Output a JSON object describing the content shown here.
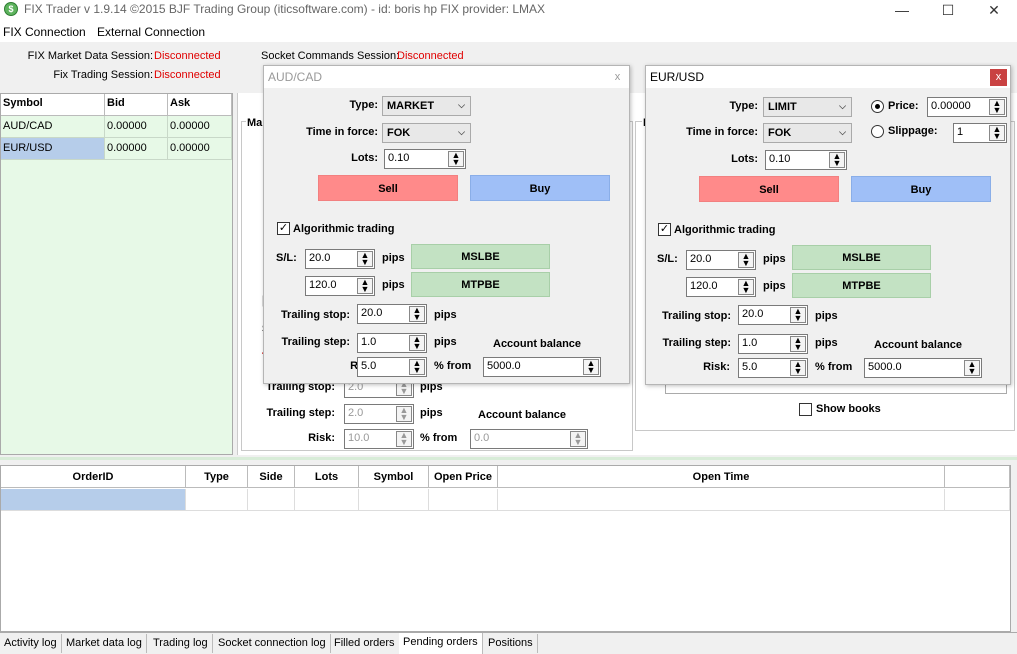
{
  "window": {
    "title": "FIX Trader v 1.9.14 ©2015 BJF Trading Group (iticsoftware.com) - id: boris hp FIX provider: LMAX",
    "min": "—",
    "max": "☐",
    "close": "✕"
  },
  "menu": [
    "FIX Connection",
    "External Connection"
  ],
  "status": {
    "md_label": "FIX Market Data Session:",
    "md_value": "Disconnected",
    "tr_label": "Fix Trading Session:",
    "tr_value": "Disconnected",
    "sock_label": "Socket Commands Session:",
    "sock_value": "Disconnected"
  },
  "symbols": {
    "headers": [
      "Symbol",
      "Bid",
      "Ask"
    ],
    "rows": [
      {
        "symbol": "AUD/CAD",
        "bid": "0.00000",
        "ask": "0.00000"
      },
      {
        "symbol": "EUR/USD",
        "bid": "0.00000",
        "ask": "0.00000"
      }
    ]
  },
  "main_panel": {
    "frag1": "Ma",
    "frag2": "E",
    "frag3": "[",
    "frag4": "S",
    "frag5": "T",
    "trailing_stop_label": "Trailing stop:",
    "trailing_stop": "2.0",
    "trailing_step_label": "Trailing step:",
    "trailing_step": "2.0",
    "risk_label": "Risk:",
    "risk": "10.0",
    "pips": "pips",
    "pct_from": "% from",
    "account_balance": "Account balance",
    "balance": "0.0",
    "show_books": "Show books"
  },
  "dialog_aud": {
    "title": "AUD/CAD",
    "close": "x",
    "type_label": "Type:",
    "type": "MARKET",
    "tif_label": "Time in force:",
    "tif": "FOK",
    "lots_label": "Lots:",
    "lots": "0.10",
    "sell": "Sell",
    "buy": "Buy",
    "algo": "Algorithmic trading",
    "sl_label": "S/L:",
    "sl": "20.0",
    "tp": "120.0",
    "pips": "pips",
    "mslbe": "MSLBE",
    "mtpbe": "MTPBE",
    "trailing_stop_label": "Trailing stop:",
    "trailing_stop": "20.0",
    "trailing_step_label": "Trailing step:",
    "trailing_step": "1.0",
    "risk_label": "Risk:",
    "risk": "5.0",
    "pct_from": "% from",
    "account_balance": "Account balance",
    "balance": "5000.0"
  },
  "dialog_eur": {
    "title": "EUR/USD",
    "close": "x",
    "type_label": "Type:",
    "type": "LIMIT",
    "price_label": "Price:",
    "price": "0.00000",
    "slippage_label": "Slippage:",
    "slippage": "1",
    "tif_label": "Time in force:",
    "tif": "FOK",
    "lots_label": "Lots:",
    "lots": "0.10",
    "sell": "Sell",
    "buy": "Buy",
    "algo": "Algorithmic trading",
    "sl_label": "S/L:",
    "sl": "20.0",
    "tp": "120.0",
    "pips": "pips",
    "mslbe": "MSLBE",
    "mtpbe": "MTPBE",
    "trailing_stop_label": "Trailing stop:",
    "trailing_stop": "20.0",
    "trailing_step_label": "Trailing step:",
    "trailing_step": "1.0",
    "risk_label": "Risk:",
    "risk": "5.0",
    "pct_from": "% from",
    "account_balance": "Account balance",
    "balance": "5000.0"
  },
  "orders": {
    "headers": [
      "OrderID",
      "Type",
      "Side",
      "Lots",
      "Symbol",
      "Open Price",
      "Open Time"
    ]
  },
  "tabs": [
    "Activity log",
    "Market data log",
    "Trading log",
    "Socket connection log",
    "Filled orders",
    "Pending orders",
    "Positions"
  ],
  "colors": {
    "sell": "#ff8a8a",
    "buy": "#9fbff7",
    "strategy": "#c3e2c3",
    "disconnected": "#e00000",
    "symbols_bg": "#e7f9e7"
  }
}
